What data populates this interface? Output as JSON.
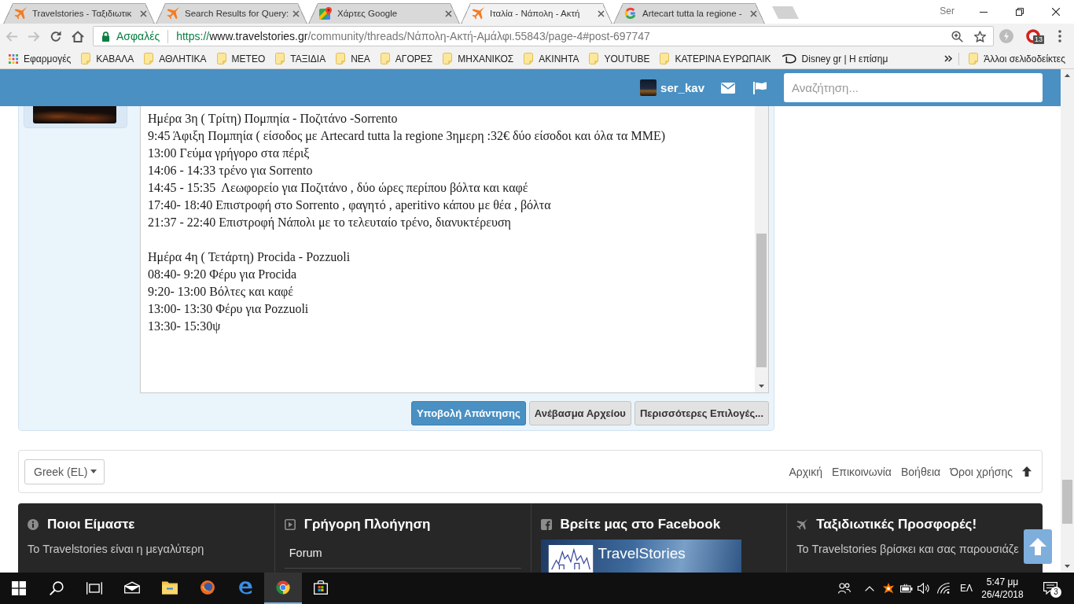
{
  "browser": {
    "tabs": [
      {
        "title": "Travelstories - Ταξιδιωτικ",
        "kind": "plane",
        "selected": false
      },
      {
        "title": "Search Results for Query:",
        "kind": "plane",
        "selected": false
      },
      {
        "title": "Χάρτες Google",
        "kind": "maps",
        "selected": false
      },
      {
        "title": "Ιταλία - Νάπολη - Ακτή",
        "kind": "plane",
        "selected": true
      },
      {
        "title": "Artecart tutta la regione -",
        "kind": "google",
        "selected": false
      }
    ],
    "profile_name": "Ser",
    "toolbar": {
      "back": {
        "disabled": true
      },
      "forward": {
        "disabled": true
      }
    },
    "address_bar": {
      "security_label": "Ασφαλές",
      "url": {
        "scheme": "https://",
        "host": "www.travelstories.gr",
        "path": "/community/threads/Νάπολη-Ακτή-Αμάλφι.55843/page-4#post-697747"
      }
    },
    "extension_badge": "13",
    "bookmarks": [
      {
        "label": "Εφαρμογές",
        "kind": "apps"
      },
      {
        "label": "ΚΑΒΑΛΑ",
        "kind": "folder"
      },
      {
        "label": "ΑΘΛΗΤΙΚΑ",
        "kind": "folder"
      },
      {
        "label": "ΜΕΤΕΟ",
        "kind": "folder"
      },
      {
        "label": "ΤΑΞΙΔΙΑ",
        "kind": "folder"
      },
      {
        "label": "ΝΕΑ",
        "kind": "folder"
      },
      {
        "label": "ΑΓΟΡΕΣ",
        "kind": "folder"
      },
      {
        "label": "ΜΗΧΑΝΙΚΟΣ",
        "kind": "folder"
      },
      {
        "label": "ΑΚΙΝΗΤΑ",
        "kind": "folder"
      },
      {
        "label": "YOUTUBE",
        "kind": "folder"
      },
      {
        "label": "ΚΑΤΕΡΙΝΑ ΕΥΡΩΠΑΙΚ",
        "kind": "folder"
      },
      {
        "label": "Disney gr | Η επίσημ",
        "kind": "site"
      }
    ],
    "other_bookmarks": {
      "label": "Άλλοι σελιδοδείκτες",
      "kind": "folder"
    }
  },
  "site_header": {
    "username": "ser_kav",
    "search": {
      "placeholder": "Αναζήτηση..."
    }
  },
  "reply": {
    "paragraphs": [
      {
        "lines": [
          "Ημέρα 3η ( Τρίτη) Πομπηία - Ποζιτάνο -Sorrento",
          "9:45 Άφιξη Πομπηία ( είσοδος με Artecard tutta la regione 3ημερη :32€ δύο είσοδοι και όλα τα ΜΜΕ)",
          "13:00 Γεύμα γρήγορο στα πέριξ",
          "14:06 - 14:33 τρένο για Sorrento",
          "14:45 - 15:35  Λεωφορείο για Ποζιτάνο , δύο ώρες περίπου βόλτα και καφέ",
          "17:40- 18:40 Επιστροφή στο Sorrento , φαγητό , aperitivo κάπου με θέα , βόλτα",
          "21:37 - 22:40 Επιστροφή Νάπολι με το τελευταίο τρένο, διανυκτέρευση"
        ]
      },
      {
        "lines": [
          "Ημέρα 4η ( Τετάρτη) Procida - Pozzuoli",
          "08:40- 9:20 Φέρυ για Procida",
          "9:20- 13:00 Βόλτες και καφέ",
          "13:00- 13:30 Φέρυ για Pozzuoli",
          "13:30- 15:30ψ"
        ]
      }
    ],
    "buttons": [
      {
        "label": "Υποβολή Απάντησης",
        "kind": "primary"
      },
      {
        "label": "Ανέβασμα Αρχείου",
        "kind": "secondary"
      },
      {
        "label": "Περισσότερες Επιλογές...",
        "kind": "secondary"
      }
    ]
  },
  "footer_nav": {
    "language": "Greek (EL)",
    "links": [
      "Αρχική",
      "Επικοινωνία",
      "Βοήθεια",
      "Όροι χρήσης"
    ]
  },
  "footer": {
    "columns": [
      {
        "kind": "about",
        "title": "Ποιοι Είμαστε",
        "text": "Το Travelstories είναι η μεγαλύτερη"
      },
      {
        "kind": "navigation",
        "title": "Γρήγορη Πλοήγηση",
        "links": [
          "Forum"
        ]
      },
      {
        "kind": "facebook",
        "title": "Βρείτε μας στο Facebook",
        "page_name": "TravelStories"
      },
      {
        "kind": "offers",
        "title": "Ταξιδιωτικές Προσφορές!",
        "text": "Το Travelstories βρίσκει και σας παρουσιάζε"
      }
    ]
  },
  "taskbar": {
    "apps": [
      {
        "kind": "mail",
        "selected": false
      },
      {
        "kind": "explorer",
        "selected": false
      },
      {
        "kind": "firefox",
        "selected": false
      },
      {
        "kind": "edge",
        "selected": false
      },
      {
        "kind": "chrome",
        "selected": true
      },
      {
        "kind": "store",
        "selected": false
      }
    ],
    "language": "ΕΛ",
    "time": "5:47 μμ",
    "date": "26/4/2018",
    "notification_count": "3"
  }
}
